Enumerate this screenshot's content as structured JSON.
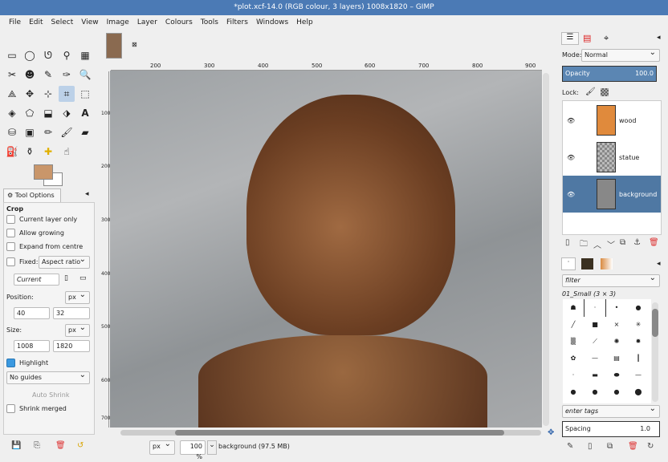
{
  "window": {
    "title": "*plot.xcf-14.0 (RGB colour, 3 layers) 1008x1820 – GIMP"
  },
  "menu": [
    "File",
    "Edit",
    "Select",
    "View",
    "Image",
    "Layer",
    "Colours",
    "Tools",
    "Filters",
    "Windows",
    "Help"
  ],
  "tool_options": {
    "tab_label": "Tool Options",
    "tool_name": "Crop",
    "current_layer_only": "Current layer only",
    "allow_growing": "Allow growing",
    "expand_from_centre": "Expand from centre",
    "fixed_label": "Fixed:",
    "fixed_value": "Aspect ratio",
    "aspect_value": "Current",
    "position_label": "Position:",
    "position_unit": "px",
    "position_x": "40",
    "position_y": "32",
    "size_label": "Size:",
    "size_unit": "px",
    "size_w": "1008",
    "size_h": "1820",
    "highlight": "Highlight",
    "guides": "No guides",
    "auto_shrink": "Auto Shrink",
    "shrink_merged": "Shrink merged"
  },
  "rulers": {
    "h": [
      "200",
      "300",
      "400",
      "500",
      "600",
      "700",
      "800",
      "900"
    ],
    "v": [
      "100",
      "200",
      "300",
      "400",
      "500",
      "600",
      "700"
    ]
  },
  "status": {
    "unit": "px",
    "zoom": "100 %",
    "info": "background (97.5 MB)"
  },
  "layers": {
    "mode_label": "Mode:",
    "mode": "Normal",
    "opacity_label": "Opacity",
    "opacity": "100.0",
    "lock_label": "Lock:",
    "items": [
      {
        "name": "wood"
      },
      {
        "name": "statue"
      },
      {
        "name": "background"
      }
    ]
  },
  "brushes": {
    "filter_placeholder": "filter",
    "brush_name": "01_Small (3 × 3)",
    "tags_placeholder": "enter tags",
    "spacing_label": "Spacing",
    "spacing": "1.0"
  },
  "colors": {
    "fg": "#c9966a",
    "bg": "#ffffff",
    "accent": "#4f78a3"
  }
}
